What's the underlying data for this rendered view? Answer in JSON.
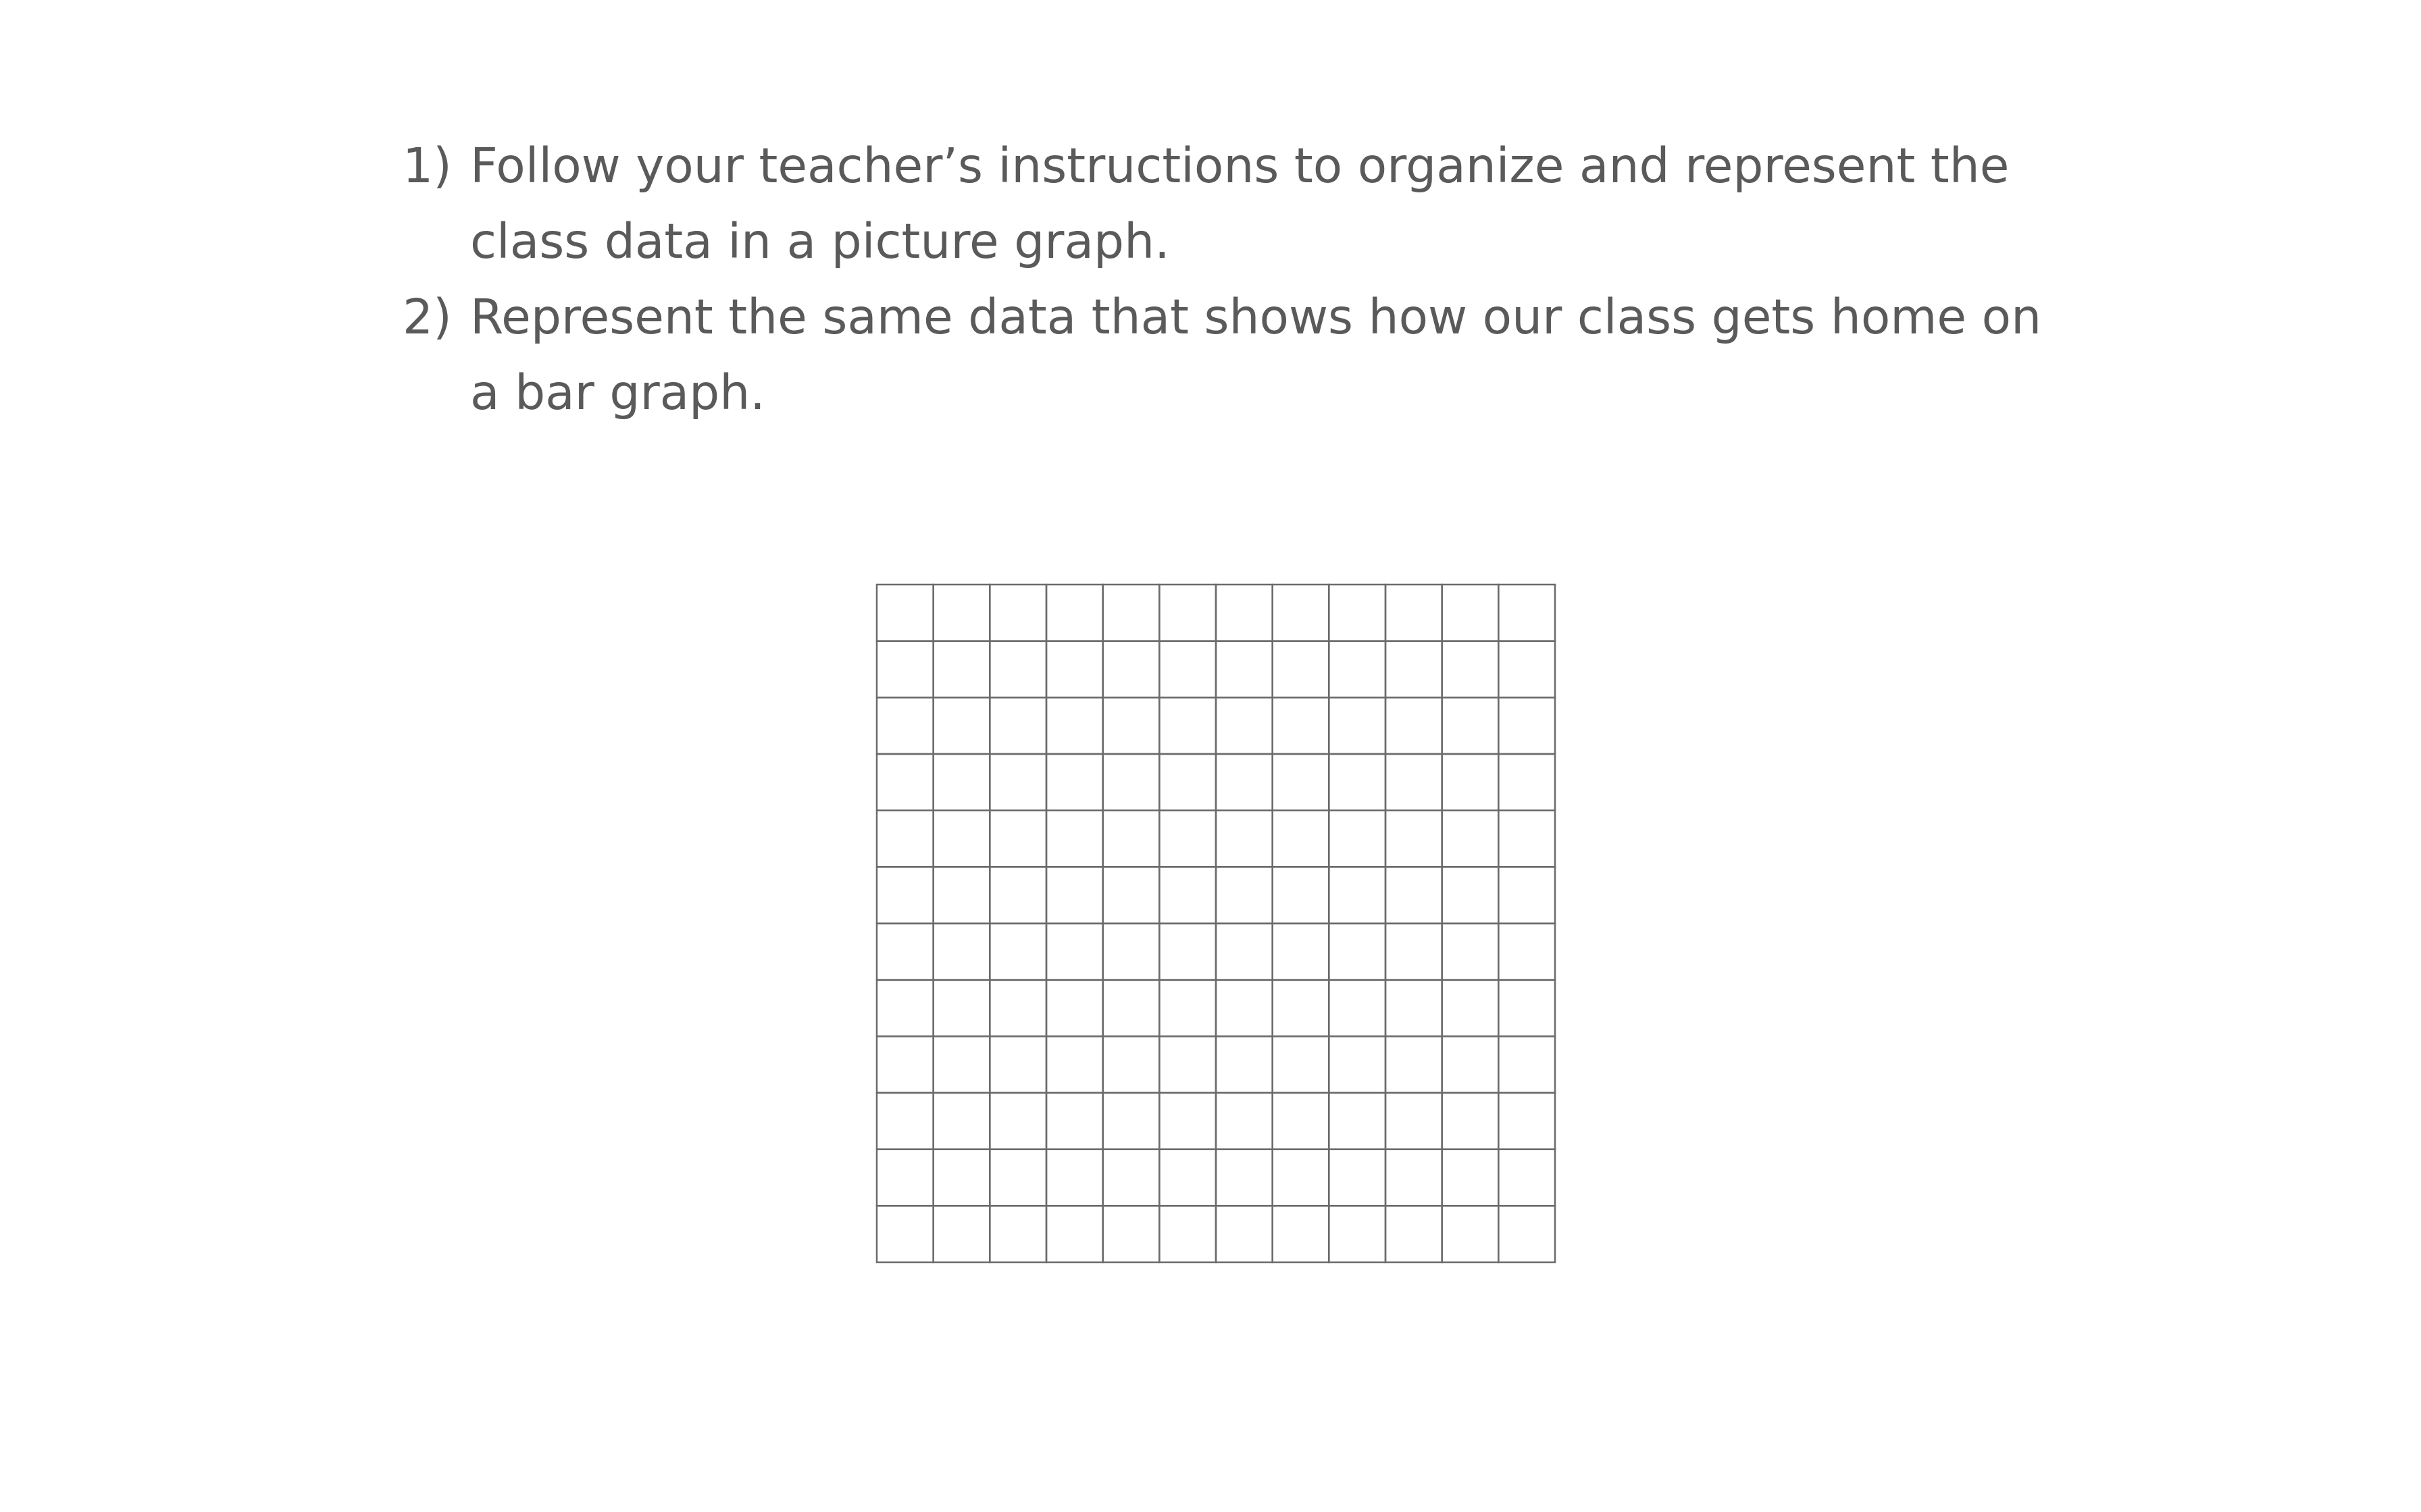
{
  "instructions": [
    {
      "number": "1)",
      "line1": "Follow your teacher’s instructions to organize and represent the",
      "line2": "class data in a picture graph."
    },
    {
      "number": "2)",
      "line1": "Represent the same data that shows how our class gets home on",
      "line2": "a bar graph."
    }
  ],
  "grid": {
    "rows": 12,
    "columns": 12,
    "line_color": "#6b6b6b"
  }
}
